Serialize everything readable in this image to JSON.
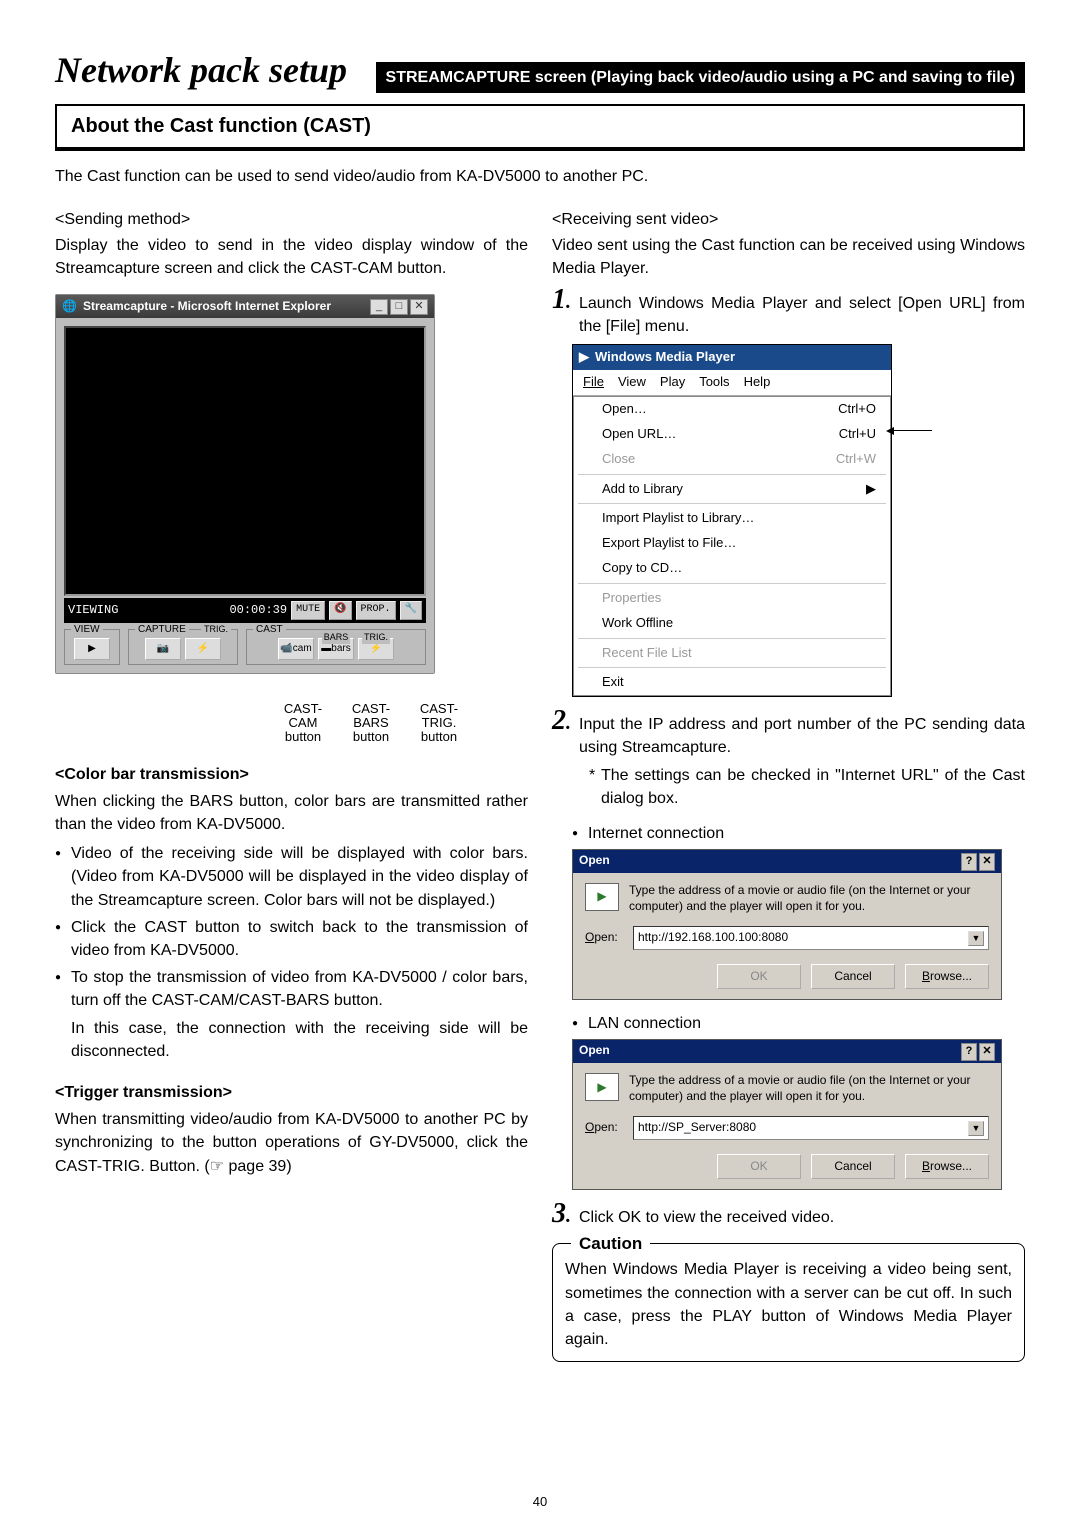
{
  "header": {
    "title": "Network pack setup",
    "subtitle": "STREAMCAPTURE screen (Playing back video/audio using a PC and saving to file)"
  },
  "section_title": "About the Cast function (CAST)",
  "intro": "The Cast function can be used to send video/audio from KA-DV5000 to another PC.",
  "left": {
    "sending_method": "<Sending method>",
    "sending_text": "Display the video to send in the video display window of the Streamcapture screen and click the CAST-CAM button.",
    "sc": {
      "title": "Streamcapture - Microsoft Internet Explorer",
      "viewing": "VIEWING",
      "time": "00:00:39",
      "mute": "MUTE",
      "speaker": "🔇",
      "prop": "PROP.",
      "tool": "🔧",
      "groups": {
        "view": "VIEW",
        "capture": "CAPTURE",
        "capture_sub": "TRIG.",
        "cast": "CAST",
        "cast_bars": "BARS",
        "cast_trig": "TRIG."
      },
      "btns": {
        "play": "▶",
        "cam1": "📷",
        "trig1": "⚡",
        "castcam": "📹cam",
        "castbars": "▬bars",
        "casttrig": "⚡"
      }
    },
    "callouts": {
      "c1a": "CAST-",
      "c1b": "CAM",
      "c1c": "button",
      "c2a": "CAST-",
      "c2b": "BARS",
      "c2c": "button",
      "c3a": "CAST-",
      "c3b": "TRIG.",
      "c3c": "button"
    },
    "color_bar_h": "<Color bar transmission>",
    "color_bar_p": "When clicking the BARS button, color bars are transmitted rather than the video from KA-DV5000.",
    "cb_b1": "Video of the receiving side will be displayed with color bars. (Video from KA-DV5000 will be displayed in the video display of the Streamcapture screen. Color bars will not be displayed.)",
    "cb_b2": "Click the CAST button to switch back to the transmission of video from KA-DV5000.",
    "cb_b3": "To stop the transmission of video from KA-DV5000 / color bars, turn off the CAST-CAM/CAST-BARS button.",
    "cb_b3b": "In this case, the connection with the receiving side will be disconnected.",
    "trigger_h": "<Trigger transmission>",
    "trigger_p": "When transmitting video/audio from KA-DV5000 to another PC by synchronizing to the button operations of GY-DV5000, click the CAST-TRIG. Button. (☞ page 39)"
  },
  "right": {
    "recv_h": "<Receiving sent video>",
    "recv_p": "Video sent using the Cast function can be received using Windows Media Player.",
    "step1": "Launch Windows Media Player and select [Open URL] from the [File] menu.",
    "wmp": {
      "title": "Windows Media Player",
      "menus": [
        "File",
        "View",
        "Play",
        "Tools",
        "Help"
      ],
      "items": [
        {
          "label": "Open…",
          "accel": "Ctrl+O",
          "dis": false
        },
        {
          "label": "Open URL…",
          "accel": "Ctrl+U",
          "dis": false,
          "pointer": true
        },
        {
          "label": "Close",
          "accel": "Ctrl+W",
          "dis": true
        },
        {
          "sep": true
        },
        {
          "label": "Add to Library",
          "accel": "▶",
          "dis": false
        },
        {
          "sep": true
        },
        {
          "label": "Import Playlist to Library…",
          "accel": "",
          "dis": false
        },
        {
          "label": "Export Playlist to File…",
          "accel": "",
          "dis": false
        },
        {
          "label": "Copy to CD…",
          "accel": "",
          "dis": false
        },
        {
          "sep": true
        },
        {
          "label": "Properties",
          "accel": "",
          "dis": true
        },
        {
          "label": "Work Offline",
          "accel": "",
          "dis": false
        },
        {
          "sep": true
        },
        {
          "label": "Recent File List",
          "accel": "",
          "dis": true
        },
        {
          "sep": true
        },
        {
          "label": "Exit",
          "accel": "",
          "dis": false
        }
      ]
    },
    "step2": "Input the IP address and port number of the PC sending data using Streamcapture.",
    "step2_note": "The settings can be checked in \"Internet URL\" of the Cast dialog box.",
    "internet_label": "Internet connection",
    "lan_label": "LAN connection",
    "dlg": {
      "title": "Open",
      "msg": "Type the address of a movie or audio file (on the Internet or your computer) and the player will open it for you.",
      "open_label": "Open:",
      "url1": "http://192.168.100.100:8080",
      "url2": "http://SP_Server:8080",
      "ok": "OK",
      "cancel": "Cancel",
      "browse": "Browse..."
    },
    "step3": "Click OK to view the received video.",
    "caution_label": "Caution",
    "caution_text": "When Windows Media Player is receiving a video being sent, sometimes the connection with a server can be cut off.  In such a case, press the PLAY button of Windows Media Player again."
  },
  "page_number": "40"
}
